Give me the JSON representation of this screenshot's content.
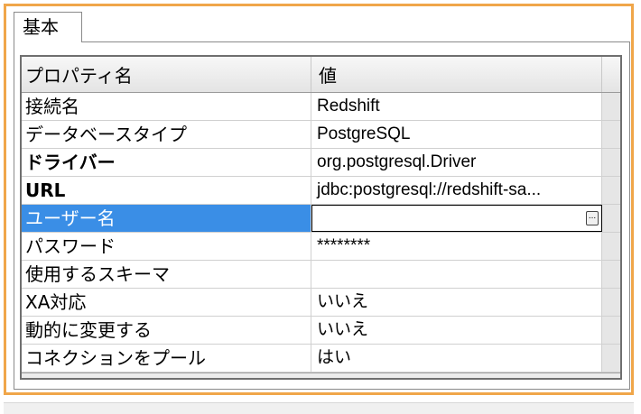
{
  "tab": {
    "label": "基本"
  },
  "header": {
    "name": "プロパティ名",
    "value": "値"
  },
  "rows": [
    {
      "name": "接続名",
      "value": "Redshift"
    },
    {
      "name": "データベースタイプ",
      "value": "PostgreSQL"
    },
    {
      "name": "ドライバー",
      "value": "org.postgresql.Driver"
    },
    {
      "name": "URL",
      "value": "jdbc:postgresql://redshift-sa..."
    },
    {
      "name": "ユーザー名",
      "value": ""
    },
    {
      "name": "パスワード",
      "value": "********"
    },
    {
      "name": "使用するスキーマ",
      "value": ""
    },
    {
      "name": "XA対応",
      "value": "いいえ"
    },
    {
      "name": "動的に変更する",
      "value": "いいえ"
    },
    {
      "name": "コネクションをプール",
      "value": "はい"
    }
  ],
  "ellipsis_button": {
    "label": "..."
  },
  "colors": {
    "frame_border": "#f0a64a",
    "selection": "#3a8ee6"
  }
}
